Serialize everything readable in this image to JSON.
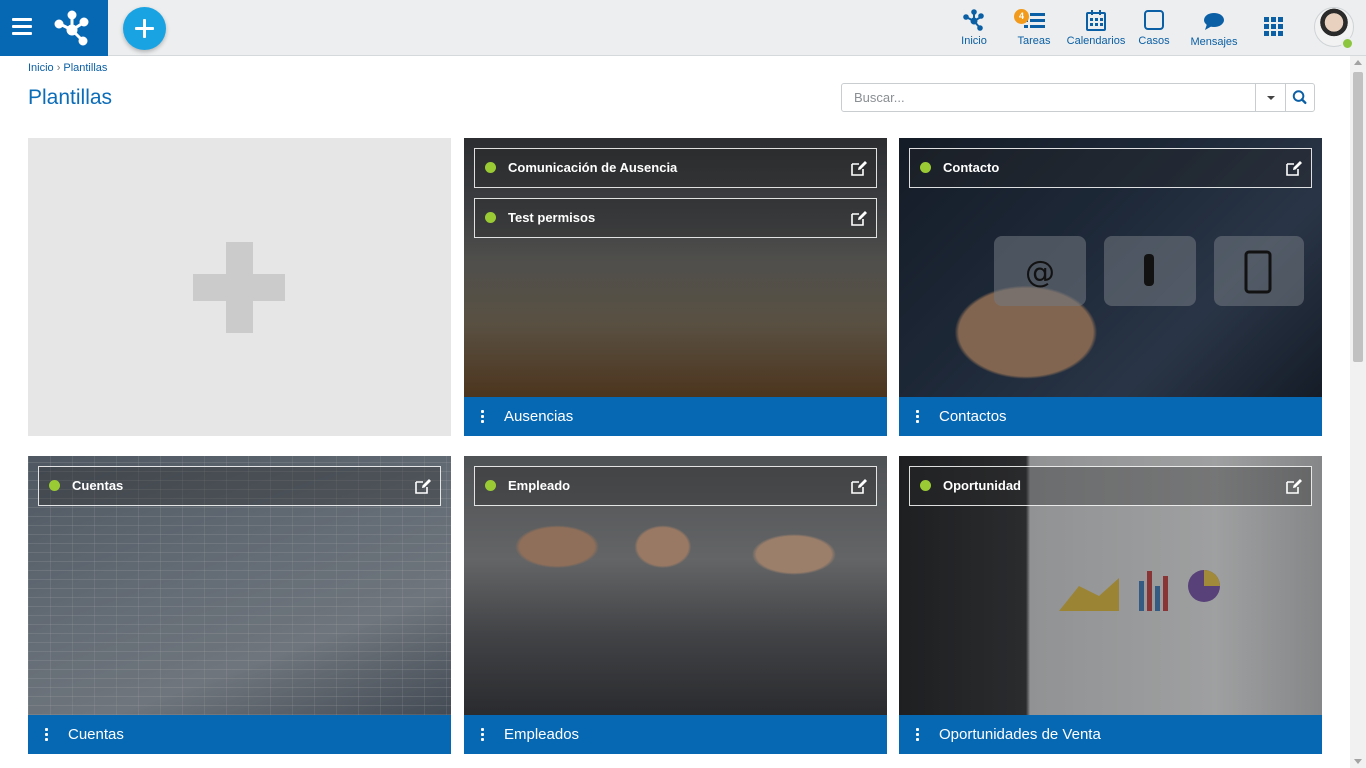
{
  "topbar": {
    "nav": [
      {
        "id": "inicio",
        "label": "Inicio",
        "icon": "deploy-logo-icon"
      },
      {
        "id": "tareas",
        "label": "Tareas",
        "icon": "tasks-icon",
        "badge": "4"
      },
      {
        "id": "calendarios",
        "label": "Calendarios",
        "icon": "calendar-icon"
      },
      {
        "id": "casos",
        "label": "Casos",
        "icon": "cases-icon"
      },
      {
        "id": "mensajes",
        "label": "Mensajes",
        "icon": "chat-bubble-icon"
      }
    ],
    "apps_icon": "apps-grid-icon",
    "accent_color": "#0667b3",
    "fab_color": "#1aa3e3",
    "badge_color": "#f29a1c",
    "online_color": "#8cc63f"
  },
  "breadcrumb": {
    "home": "Inicio",
    "separator": "›",
    "current": "Plantillas"
  },
  "page": {
    "title": "Plantillas"
  },
  "search": {
    "placeholder": "Buscar...",
    "value": ""
  },
  "cards": [
    {
      "title": "Ausencias",
      "items": [
        {
          "label": "Comunicación de Ausencia"
        },
        {
          "label": "Test permisos"
        }
      ]
    },
    {
      "title": "Contactos",
      "items": [
        {
          "label": "Contacto"
        }
      ]
    },
    {
      "title": "Cuentas",
      "items": [
        {
          "label": "Cuentas"
        }
      ]
    },
    {
      "title": "Empleados",
      "items": [
        {
          "label": "Empleado"
        }
      ]
    },
    {
      "title": "Oportunidades de Venta",
      "items": [
        {
          "label": "Oportunidad"
        }
      ]
    }
  ]
}
